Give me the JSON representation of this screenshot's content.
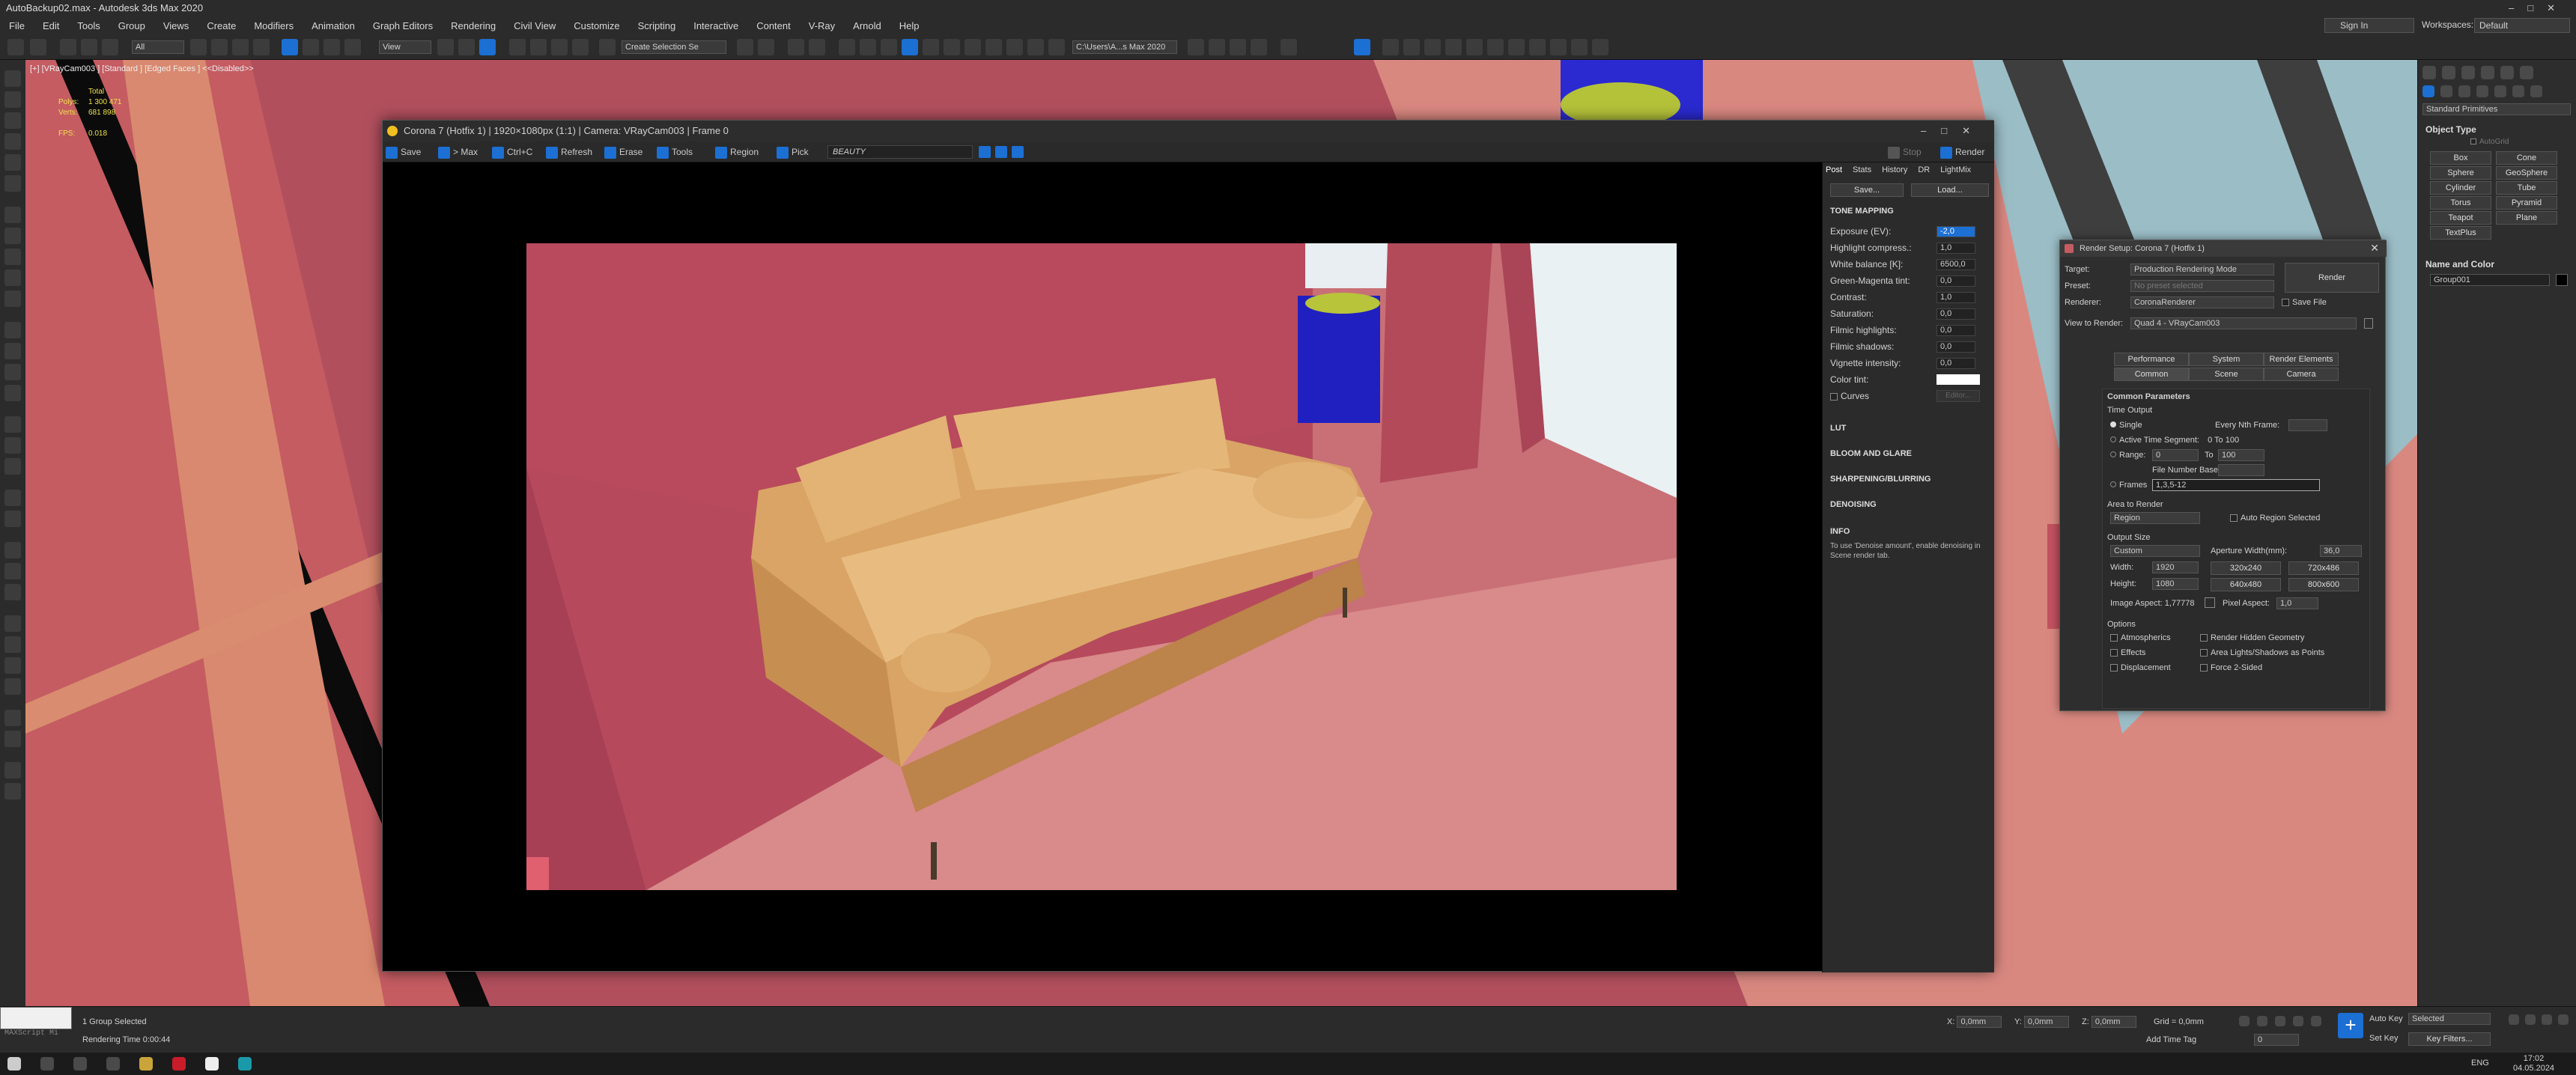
{
  "app_title": "AutoBackup02.max - Autodesk 3ds Max 2020",
  "menu": [
    "File",
    "Edit",
    "Tools",
    "Group",
    "Views",
    "Create",
    "Modifiers",
    "Animation",
    "Graph Editors",
    "Rendering",
    "Civil View",
    "Customize",
    "Scripting",
    "Interactive",
    "Content",
    "V-Ray",
    "Arnold",
    "Help"
  ],
  "toolbar": {
    "selection_filter": "All",
    "view_dropdown": "View",
    "create_selection_set": "Create Selection Se",
    "path": "C:\\Users\\A...s Max 2020",
    "sign_in": "Sign In",
    "workspaces_label": "Workspaces:",
    "workspace": "Default"
  },
  "viewport": {
    "label": "[+] [VRayCam003 ] [Standard ] [Edged Faces ] <<Disabled>>",
    "stats": {
      "total_label": "Total",
      "polys_label": "Polys:",
      "polys": "1 300 471",
      "verts_label": "Verts:",
      "verts": "681 898",
      "fps_label": "FPS:",
      "fps": "0.018"
    }
  },
  "vfb": {
    "title": "Corona 7 (Hotfix 1) | 1920×1080px (1:1) | Camera: VRayCam003 | Frame 0",
    "toolbar": [
      "Save",
      "> Max",
      "Ctrl+C",
      "Refresh",
      "Erase",
      "Tools",
      "Region",
      "Pick"
    ],
    "channel": "BEAUTY",
    "stop": "Stop",
    "render": "Render",
    "tabs": [
      "Post",
      "Stats",
      "History",
      "DR",
      "LightMix"
    ],
    "save": "Save...",
    "load": "Load...",
    "tone_mapping": "TONE MAPPING",
    "params": [
      {
        "label": "Exposure (EV):",
        "value": "-2,0"
      },
      {
        "label": "Highlight compress.:",
        "value": "1,0"
      },
      {
        "label": "White balance [K]:",
        "value": "6500,0"
      },
      {
        "label": "Green-Magenta tint:",
        "value": "0,0"
      },
      {
        "label": "Contrast:",
        "value": "1,0"
      },
      {
        "label": "Saturation:",
        "value": "0,0"
      },
      {
        "label": "Filmic highlights:",
        "value": "0,0"
      },
      {
        "label": "Filmic shadows:",
        "value": "0,0"
      },
      {
        "label": "Vignette intensity:",
        "value": "0,0"
      }
    ],
    "color_tint": "Color tint:",
    "curves": "Curves",
    "curves_editor": "Editor...",
    "sections": [
      "LUT",
      "BLOOM AND GLARE",
      "SHARPENING/BLURRING",
      "DENOISING"
    ],
    "info_title": "INFO",
    "info_text": "To use 'Denoise amount', enable denoising in Scene render tab."
  },
  "render_setup": {
    "title": "Render Setup: Corona 7 (Hotfix 1)",
    "target_label": "Target:",
    "target": "Production Rendering Mode",
    "preset_label": "Preset:",
    "preset": "No preset selected",
    "renderer_label": "Renderer:",
    "renderer": "CoronaRenderer",
    "save_file": "Save File",
    "view_label": "View to Render:",
    "view": "Quad 4 - VRayCam003",
    "render_btn": "Render",
    "tabs_top": [
      "Performance",
      "System",
      "Render Elements"
    ],
    "tabs_bottom": [
      "Common",
      "Scene",
      "Camera"
    ],
    "common_params": "Common Parameters",
    "time_output": "Time Output",
    "single": "Single",
    "every_nth": "Every Nth Frame:",
    "active_segment": "Active Time Segment:",
    "active_range": "0 To 100",
    "range": "Range:",
    "range_from": "0",
    "to": "To",
    "range_to": "100",
    "file_number_base": "File Number Base:",
    "frames": "Frames",
    "frames_value": "1,3,5-12",
    "area_to_render": "Area to Render",
    "area": "Region",
    "auto_region": "Auto Region Selected",
    "output_size": "Output Size",
    "output_preset": "Custom",
    "aperture": "Aperture Width(mm):",
    "aperture_value": "36,0",
    "width_label": "Width:",
    "width": "1920",
    "height_label": "Height:",
    "height": "1080",
    "presets": [
      "320x240",
      "720x486",
      "640x480",
      "800x600"
    ],
    "image_aspect": "Image Aspect: 1,77778",
    "pixel_aspect": "Pixel Aspect:",
    "pixel_aspect_value": "1,0",
    "options": "Options",
    "opt_left": [
      "Atmospherics",
      "Effects",
      "Displacement"
    ],
    "opt_right": [
      "Render Hidden Geometry",
      "Area Lights/Shadows as Points",
      "Force 2-Sided"
    ]
  },
  "command_panel": {
    "dropdown": "Standard Primitives",
    "object_type": "Object Type",
    "autogrid": "AutoGrid",
    "buttons": [
      "Box",
      "Cone",
      "Sphere",
      "GeoSphere",
      "Cylinder",
      "Tube",
      "Torus",
      "Pyramid",
      "Teapot",
      "Plane",
      "TextPlus"
    ],
    "name_color": "Name and Color",
    "name": "Group001"
  },
  "status": {
    "maxscript": "MAXScript Mi",
    "selected": "1 Group Selected",
    "render_time": "Rendering Time  0:00:44",
    "x": "0,0mm",
    "y": "0,0mm",
    "z": "0,0mm",
    "grid": "Grid = 0,0mm",
    "add_time_tag": "Add Time Tag",
    "frame": "0",
    "auto_key": "Auto Key",
    "set_key": "Set Key",
    "selected_dd": "Selected",
    "key_filters": "Key Filters..."
  },
  "taskbar": {
    "lang": "ENG",
    "time": "17:02",
    "date": "04.05.2024"
  }
}
